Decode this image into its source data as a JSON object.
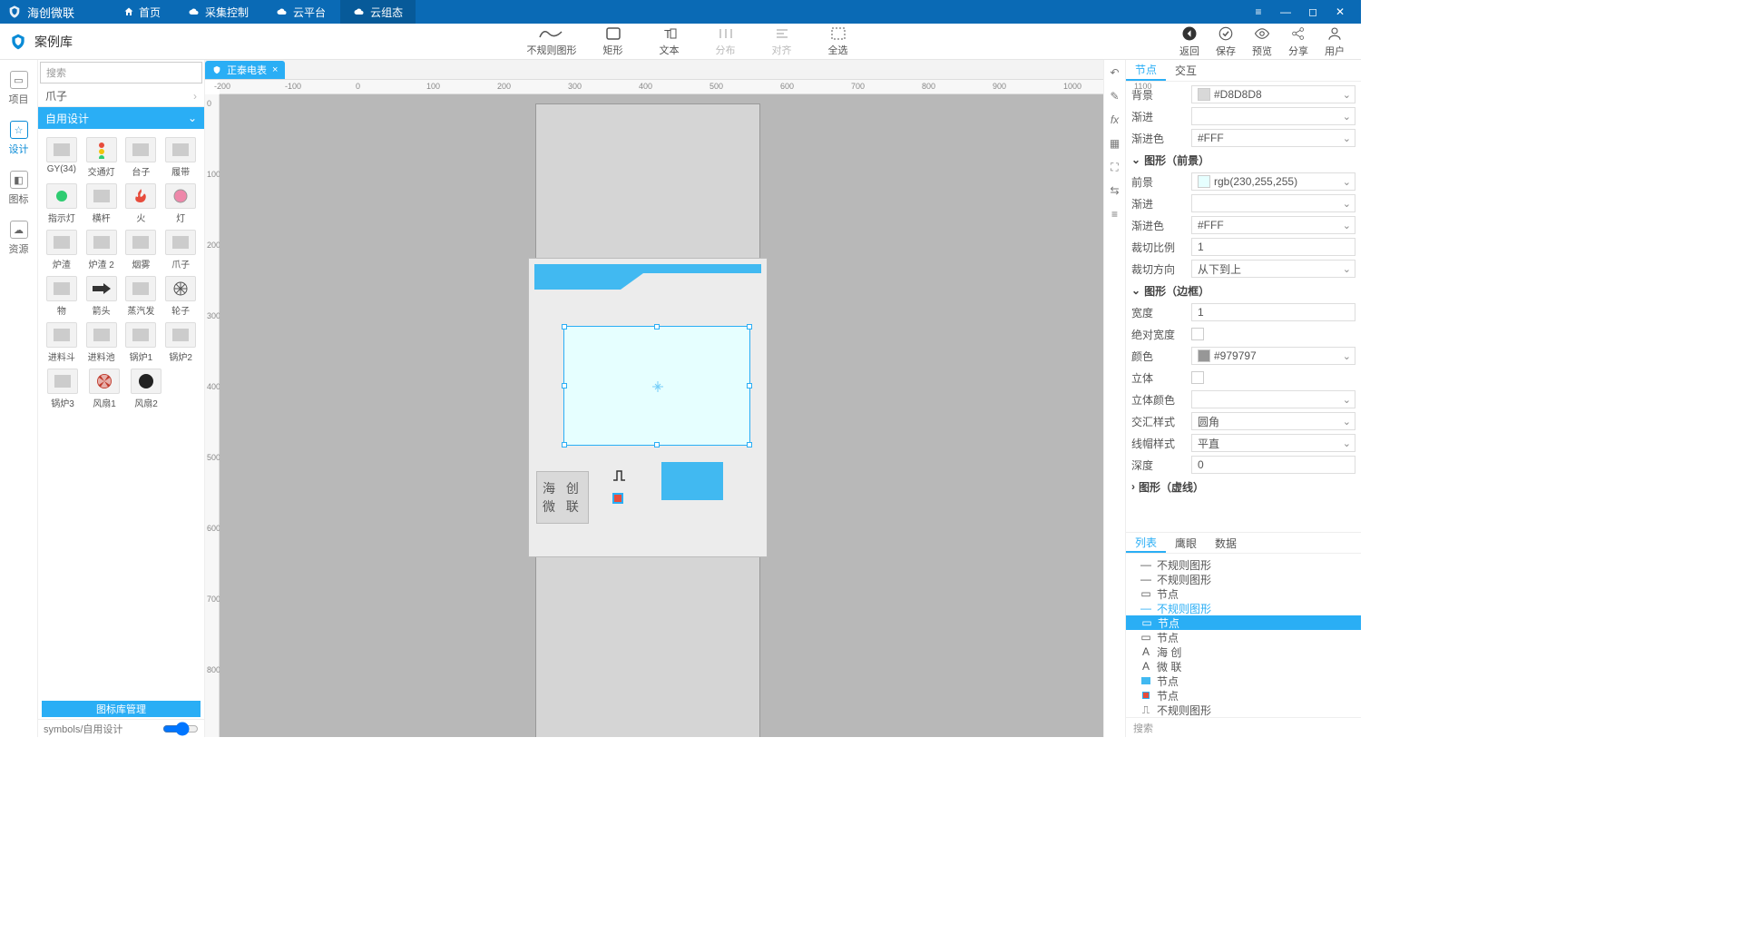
{
  "app_name": "海创微联",
  "nav": [
    "首页",
    "采集控制",
    "云平台",
    "云组态"
  ],
  "nav_active_index": 3,
  "subheader": {
    "title": "案例库",
    "tools": [
      {
        "key": "freeform",
        "label": "不规则图形"
      },
      {
        "key": "rect",
        "label": "矩形"
      },
      {
        "key": "text",
        "label": "文本"
      },
      {
        "key": "distribute",
        "label": "分布",
        "disabled": true
      },
      {
        "key": "align",
        "label": "对齐",
        "disabled": true
      },
      {
        "key": "selectall",
        "label": "全选"
      }
    ],
    "right": [
      {
        "key": "back",
        "label": "返回"
      },
      {
        "key": "save",
        "label": "保存"
      },
      {
        "key": "preview",
        "label": "预览"
      },
      {
        "key": "share",
        "label": "分享"
      },
      {
        "key": "user",
        "label": "用户"
      }
    ]
  },
  "rail": [
    {
      "key": "project",
      "label": "项目"
    },
    {
      "key": "design",
      "label": "设计",
      "active": true
    },
    {
      "key": "icons",
      "label": "图标"
    },
    {
      "key": "resource",
      "label": "资源"
    }
  ],
  "library": {
    "search_placeholder": "搜索",
    "crumb": "爪子",
    "section": "自用设计",
    "items": [
      [
        "GY(34)",
        "交通灯",
        "台子",
        "履带"
      ],
      [
        "指示灯",
        "横杆",
        "火",
        "灯"
      ],
      [
        "炉渣",
        "炉渣 2",
        "烟雾",
        "爪子"
      ],
      [
        "物",
        "箭头",
        "蒸汽发",
        "轮子"
      ],
      [
        "进料斗",
        "进料池",
        "锅炉1",
        "锅炉2"
      ],
      [
        "锅炉3",
        "风扇1",
        "风扇2",
        ""
      ]
    ],
    "footer": "图标库管理",
    "path": "symbols/自用设计"
  },
  "canvas": {
    "tab": "正泰电表",
    "ruler_h": [
      -200,
      -100,
      0,
      100,
      200,
      300,
      400,
      500,
      600,
      700,
      800,
      900,
      1000,
      1100
    ],
    "ruler_v": [
      0,
      100,
      200,
      300,
      400,
      500,
      600,
      700,
      800
    ],
    "brand_text": [
      "海 创",
      "微 联"
    ]
  },
  "right_rail_icons": [
    "undo",
    "pen",
    "fx",
    "grid",
    "fullscreen",
    "align-h",
    "align-v"
  ],
  "props": {
    "tabs": [
      "节点",
      "交互"
    ],
    "active_tab": 0,
    "rows": [
      {
        "label": "背景",
        "value": "#D8D8D8",
        "swatch": "#D8D8D8",
        "dd": true
      },
      {
        "label": "渐进",
        "value": "",
        "dd": true
      },
      {
        "label": "渐进色",
        "value": "#FFF",
        "dd": true
      }
    ],
    "group_fg": "图形（前景）",
    "fg_rows": [
      {
        "label": "前景",
        "value": "rgb(230,255,255)",
        "swatch": "rgb(230,255,255)",
        "dd": true
      },
      {
        "label": "渐进",
        "value": "",
        "dd": true
      },
      {
        "label": "渐进色",
        "value": "#FFF",
        "dd": true
      },
      {
        "label": "裁切比例",
        "value": "1"
      },
      {
        "label": "裁切方向",
        "value": "从下到上",
        "dd": true
      }
    ],
    "group_border": "图形（边框）",
    "border_rows": [
      {
        "label": "宽度",
        "value": "1"
      },
      {
        "label": "绝对宽度",
        "checkbox": true
      },
      {
        "label": "颜色",
        "value": "#979797",
        "swatch": "#979797",
        "dd": true
      },
      {
        "label": "立体",
        "checkbox": true
      },
      {
        "label": "立体颜色",
        "value": "",
        "dd": true
      },
      {
        "label": "交汇样式",
        "value": "圆角",
        "dd": true
      },
      {
        "label": "线帽样式",
        "value": "平直",
        "dd": true
      },
      {
        "label": "深度",
        "value": "0"
      }
    ],
    "group_dash": "图形（虚线）",
    "bottom_tabs": [
      "列表",
      "鹰眼",
      "数据"
    ],
    "bottom_active": 0,
    "tree": [
      {
        "icon": "line",
        "label": "不规则图形"
      },
      {
        "icon": "line",
        "label": "不规则图形"
      },
      {
        "icon": "box",
        "label": "节点"
      },
      {
        "icon": "line",
        "label": "不规则图形",
        "blue": true
      },
      {
        "icon": "box",
        "label": "节点",
        "selected": true
      },
      {
        "icon": "box",
        "label": "节点"
      },
      {
        "icon": "A",
        "label": "海 创"
      },
      {
        "icon": "A",
        "label": "微 联"
      },
      {
        "icon": "cyan",
        "label": "节点"
      },
      {
        "icon": "red",
        "label": "节点"
      },
      {
        "icon": "pulse",
        "label": "不规则图形"
      }
    ],
    "search_placeholder": "搜索"
  }
}
